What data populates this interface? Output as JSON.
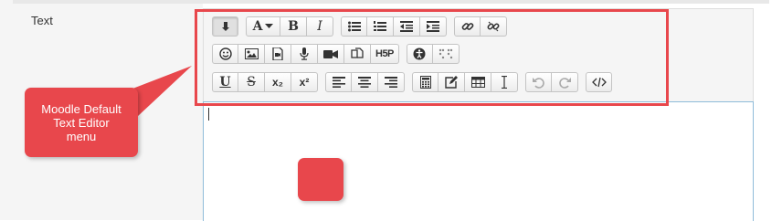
{
  "form": {
    "field_label": "Text"
  },
  "annotation": {
    "callout_text": "Moodle Default Text Editor menu",
    "accent_color": "#e8474c"
  },
  "toolbar": {
    "row1": [
      [
        {
          "name": "show-more-buttons",
          "icon": "collapse-icon"
        }
      ],
      [
        {
          "name": "font-style",
          "label": "A",
          "icon": "font-dropdown-icon"
        },
        {
          "name": "bold",
          "label": "B"
        },
        {
          "name": "italic",
          "label": "I"
        }
      ],
      [
        {
          "name": "unordered-list",
          "icon": "bullet-list-icon"
        },
        {
          "name": "ordered-list",
          "icon": "number-list-icon"
        },
        {
          "name": "outdent",
          "icon": "outdent-icon"
        },
        {
          "name": "indent",
          "icon": "indent-icon"
        }
      ],
      [
        {
          "name": "link",
          "icon": "link-icon"
        },
        {
          "name": "unlink",
          "icon": "unlink-icon"
        }
      ]
    ],
    "row2": [
      [
        {
          "name": "emoticon",
          "icon": "smiley-icon"
        },
        {
          "name": "image",
          "icon": "image-icon"
        },
        {
          "name": "media",
          "icon": "media-file-icon"
        },
        {
          "name": "record-audio",
          "icon": "microphone-icon"
        },
        {
          "name": "record-video",
          "icon": "video-camera-icon"
        },
        {
          "name": "manage-files",
          "icon": "files-icon"
        },
        {
          "name": "h5p",
          "label": "H5P"
        }
      ],
      [
        {
          "name": "accessibility-checker",
          "icon": "accessibility-icon"
        },
        {
          "name": "screenreader-helper",
          "icon": "braille-icon"
        }
      ]
    ],
    "row3": [
      [
        {
          "name": "underline",
          "label": "U"
        },
        {
          "name": "strikethrough",
          "label": "S"
        },
        {
          "name": "subscript",
          "label": "x₂"
        },
        {
          "name": "superscript",
          "label": "x²"
        }
      ],
      [
        {
          "name": "align-left",
          "icon": "align-left-icon"
        },
        {
          "name": "align-center",
          "icon": "align-center-icon"
        },
        {
          "name": "align-right",
          "icon": "align-right-icon"
        }
      ],
      [
        {
          "name": "equation",
          "icon": "calculator-icon"
        },
        {
          "name": "special-character",
          "icon": "pencil-square-icon"
        },
        {
          "name": "table",
          "icon": "table-icon"
        },
        {
          "name": "clear-formatting",
          "icon": "i-cursor-icon"
        }
      ],
      [
        {
          "name": "undo",
          "icon": "undo-icon"
        },
        {
          "name": "redo",
          "icon": "redo-icon"
        }
      ],
      [
        {
          "name": "html-source",
          "icon": "code-icon"
        }
      ]
    ]
  }
}
